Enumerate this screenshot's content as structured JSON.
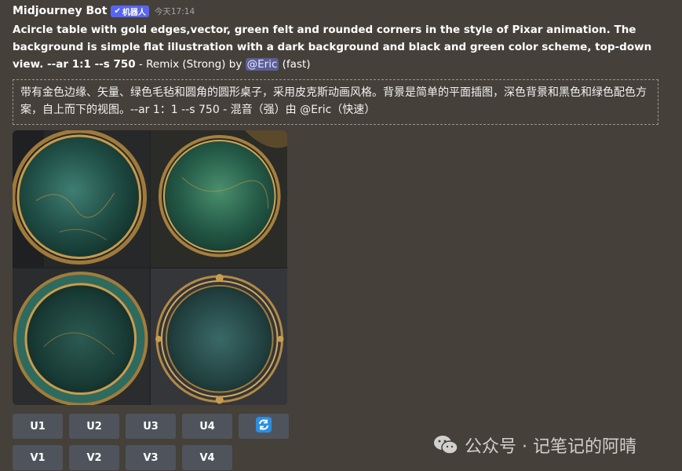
{
  "message": {
    "author": "Midjourney Bot",
    "badge": "机器人",
    "timestamp": "今天17:14",
    "prompt_bold": "Acircle table with gold edges,vector, green felt and rounded corners in the style of Pixar animation. The background is simple flat illustration with a dark background and black and green color scheme, top-down view. --ar 1:1 --s 750",
    "prompt_suffix": " - Remix (Strong) by ",
    "mention": "@Eric",
    "speed": " (fast)",
    "translation": "带有金色边缘、矢量、绿色毛毡和圆角的圆形桌子，采用皮克斯动画风格。背景是简单的平面插图，深色背景和黑色和绿色配色方案，自上而下的视图。--ar 1：1 --s 750 - 混音（强）由 @Eric（快速）"
  },
  "buttons": {
    "upscale": [
      "U1",
      "U2",
      "U3",
      "U4"
    ],
    "variation": [
      "V1",
      "V2",
      "V3",
      "V4"
    ],
    "refresh_icon": "refresh-icon"
  },
  "colors": {
    "background": "#45403a",
    "button": "#4f545c",
    "badge": "#5865f2",
    "refresh": "#2a8fe6"
  },
  "watermark": {
    "text": "公众号 · 记笔记的阿晴",
    "icon": "wechat-icon"
  }
}
